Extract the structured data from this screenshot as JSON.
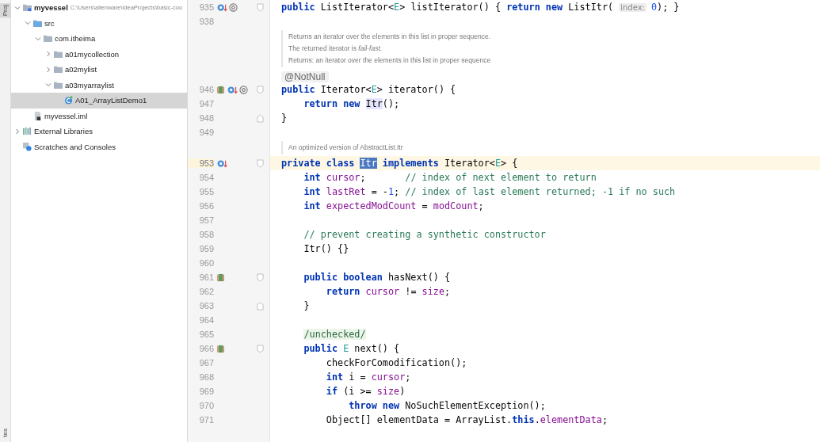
{
  "side_tabs": [
    {
      "label": "Proj"
    },
    {
      "label": "tes"
    }
  ],
  "tree": [
    {
      "label": "myvessel",
      "path": "C:\\Users\\alienware\\IdeaProjects\\basic-coo",
      "kind": "module",
      "expanded": true,
      "selected": false,
      "children": [
        {
          "label": "src",
          "kind": "source-folder",
          "expanded": true,
          "selected": false,
          "children": [
            {
              "label": "com.itheima",
              "kind": "package",
              "expanded": true,
              "selected": false,
              "children": [
                {
                  "label": "a01mycollection",
                  "kind": "package",
                  "expanded": false,
                  "selected": false
                },
                {
                  "label": "a02mylist",
                  "kind": "package",
                  "expanded": false,
                  "selected": false
                },
                {
                  "label": "a03myarraylist",
                  "kind": "package",
                  "expanded": true,
                  "selected": false,
                  "children": [
                    {
                      "label": "A01_ArrayListDemo1",
                      "kind": "class",
                      "selected": true
                    }
                  ]
                }
              ]
            }
          ]
        },
        {
          "label": "myvessel.iml",
          "kind": "iml",
          "selected": false
        }
      ]
    },
    {
      "label": "External Libraries",
      "kind": "libraries",
      "expanded": false,
      "selected": false
    },
    {
      "label": "Scratches and Consoles",
      "kind": "scratches",
      "selected": false
    }
  ],
  "editor_rows": [
    {
      "kind": "code",
      "number": "935",
      "current": false,
      "gutter": [
        {
          "kind": "overridden"
        },
        {
          "kind": "at"
        },
        {
          "kind": "fold-start"
        }
      ],
      "tokens": [
        {
          "t": "public ",
          "kind": "kw"
        },
        {
          "t": "ListIterator<",
          "kind": "plain"
        },
        {
          "t": "E",
          "kind": "tparam"
        },
        {
          "t": "> listIterator() { ",
          "kind": "plain"
        },
        {
          "t": "return new ",
          "kind": "kw"
        },
        {
          "t": "ListItr( ",
          "kind": "plain"
        },
        {
          "t": "index:",
          "kind": "hint"
        },
        {
          "t": "0",
          "kind": "num"
        },
        {
          "t": "); }",
          "kind": "plain"
        }
      ]
    },
    {
      "kind": "code",
      "number": "938",
      "current": false,
      "gutter": [],
      "tokens": []
    },
    {
      "kind": "doc",
      "lines": [
        "Returns an iterator over the elements in this list in proper sequence.",
        "The returned iterator is *fail-fast*.",
        "Returns: an iterator over the elements in this list in proper sequence"
      ]
    },
    {
      "kind": "annotation",
      "text": "@NotNull"
    },
    {
      "kind": "code",
      "number": "946",
      "current": false,
      "gutter": [
        {
          "kind": "implements"
        },
        {
          "kind": "overridden"
        },
        {
          "kind": "at"
        },
        {
          "kind": "fold-start"
        }
      ],
      "tokens": [
        {
          "t": "public ",
          "kind": "kw"
        },
        {
          "t": "Iterator<",
          "kind": "plain"
        },
        {
          "t": "E",
          "kind": "tparam"
        },
        {
          "t": "> iterator() {",
          "kind": "plain"
        }
      ]
    },
    {
      "kind": "code",
      "number": "947",
      "current": false,
      "gutter": [],
      "tokens": [
        {
          "t": "    return new ",
          "kind": "kw"
        },
        {
          "t": "Itr",
          "kind": "usage"
        },
        {
          "t": "();",
          "kind": "plain"
        }
      ]
    },
    {
      "kind": "code",
      "number": "948",
      "current": false,
      "gutter": [
        {
          "kind": "fold-end"
        }
      ],
      "tokens": [
        {
          "t": "}",
          "kind": "plain"
        }
      ]
    },
    {
      "kind": "code",
      "number": "949",
      "current": false,
      "gutter": [],
      "tokens": []
    },
    {
      "kind": "doc",
      "lines": [
        "An optimized version of AbstractList.Itr"
      ]
    },
    {
      "kind": "code",
      "number": "953",
      "current": true,
      "gutter": [
        {
          "kind": "overridden"
        },
        {
          "kind": "fold-start"
        }
      ],
      "tokens": [
        {
          "t": "private class ",
          "kind": "kw"
        },
        {
          "t": "Itr",
          "kind": "selection"
        },
        {
          "t": " implements ",
          "kind": "kw"
        },
        {
          "t": "Iterator<",
          "kind": "plain"
        },
        {
          "t": "E",
          "kind": "tparam"
        },
        {
          "t": "> {",
          "kind": "plain"
        }
      ]
    },
    {
      "kind": "code",
      "number": "954",
      "current": false,
      "gutter": [],
      "tokens": [
        {
          "t": "    int ",
          "kind": "kw"
        },
        {
          "t": "cursor",
          "kind": "field"
        },
        {
          "t": ";       ",
          "kind": "plain"
        },
        {
          "t": "// index of next element to return",
          "kind": "comment"
        }
      ]
    },
    {
      "kind": "code",
      "number": "955",
      "current": false,
      "gutter": [],
      "tokens": [
        {
          "t": "    int ",
          "kind": "kw"
        },
        {
          "t": "lastRet",
          "kind": "field"
        },
        {
          "t": " = -",
          "kind": "plain"
        },
        {
          "t": "1",
          "kind": "num"
        },
        {
          "t": "; ",
          "kind": "plain"
        },
        {
          "t": "// index of last element returned; -1 if no such",
          "kind": "comment"
        }
      ]
    },
    {
      "kind": "code",
      "number": "956",
      "current": false,
      "gutter": [],
      "tokens": [
        {
          "t": "    int ",
          "kind": "kw"
        },
        {
          "t": "expectedModCount",
          "kind": "field"
        },
        {
          "t": " = ",
          "kind": "plain"
        },
        {
          "t": "modCount",
          "kind": "field"
        },
        {
          "t": ";",
          "kind": "plain"
        }
      ]
    },
    {
      "kind": "code",
      "number": "957",
      "current": false,
      "gutter": [],
      "tokens": []
    },
    {
      "kind": "code",
      "number": "958",
      "current": false,
      "gutter": [],
      "tokens": [
        {
          "t": "    // prevent creating a synthetic constructor",
          "kind": "comment"
        }
      ]
    },
    {
      "kind": "code",
      "number": "959",
      "current": false,
      "gutter": [],
      "tokens": [
        {
          "t": "    Itr() {}",
          "kind": "plain"
        }
      ]
    },
    {
      "kind": "code",
      "number": "960",
      "current": false,
      "gutter": [],
      "tokens": []
    },
    {
      "kind": "code",
      "number": "961",
      "current": false,
      "gutter": [
        {
          "kind": "implements"
        },
        {
          "kind": "fold-start"
        }
      ],
      "tokens": [
        {
          "t": "    public boolean ",
          "kind": "kw"
        },
        {
          "t": "hasNext() {",
          "kind": "plain"
        }
      ]
    },
    {
      "kind": "code",
      "number": "962",
      "current": false,
      "gutter": [],
      "tokens": [
        {
          "t": "        return ",
          "kind": "kw"
        },
        {
          "t": "cursor",
          "kind": "field"
        },
        {
          "t": " != ",
          "kind": "plain"
        },
        {
          "t": "size",
          "kind": "field"
        },
        {
          "t": ";",
          "kind": "plain"
        }
      ]
    },
    {
      "kind": "code",
      "number": "963",
      "current": false,
      "gutter": [
        {
          "kind": "fold-end"
        }
      ],
      "tokens": [
        {
          "t": "    }",
          "kind": "plain"
        }
      ]
    },
    {
      "kind": "code",
      "number": "964",
      "current": false,
      "gutter": [],
      "tokens": []
    },
    {
      "kind": "code",
      "number": "965",
      "current": false,
      "gutter": [],
      "tokens": [
        {
          "t": "    /unchecked/",
          "kind": "inlay"
        }
      ]
    },
    {
      "kind": "code",
      "number": "966",
      "current": false,
      "gutter": [
        {
          "kind": "implements"
        },
        {
          "kind": "fold-start"
        }
      ],
      "tokens": [
        {
          "t": "    public ",
          "kind": "kw"
        },
        {
          "t": "E",
          "kind": "tparam"
        },
        {
          "t": " next() {",
          "kind": "plain"
        }
      ]
    },
    {
      "kind": "code",
      "number": "967",
      "current": false,
      "gutter": [],
      "tokens": [
        {
          "t": "        checkForComodification();",
          "kind": "plain"
        }
      ]
    },
    {
      "kind": "code",
      "number": "968",
      "current": false,
      "gutter": [],
      "tokens": [
        {
          "t": "        int ",
          "kind": "kw"
        },
        {
          "t": "i = ",
          "kind": "plain"
        },
        {
          "t": "cursor",
          "kind": "field"
        },
        {
          "t": ";",
          "kind": "plain"
        }
      ]
    },
    {
      "kind": "code",
      "number": "969",
      "current": false,
      "gutter": [],
      "tokens": [
        {
          "t": "        if ",
          "kind": "kw"
        },
        {
          "t": "(i >= ",
          "kind": "plain"
        },
        {
          "t": "size",
          "kind": "field"
        },
        {
          "t": ")",
          "kind": "plain"
        }
      ]
    },
    {
      "kind": "code",
      "number": "970",
      "current": false,
      "gutter": [],
      "tokens": [
        {
          "t": "            throw new ",
          "kind": "kw"
        },
        {
          "t": "NoSuchElementException();",
          "kind": "plain"
        }
      ]
    },
    {
      "kind": "code",
      "number": "971",
      "current": false,
      "gutter": [],
      "tokens": [
        {
          "t": "        Object[] elementData = ArrayList.",
          "kind": "plain"
        },
        {
          "t": "this",
          "kind": "kw"
        },
        {
          "t": ".",
          "kind": "plain"
        },
        {
          "t": "elementData",
          "kind": "field"
        },
        {
          "t": ";",
          "kind": "plain"
        }
      ]
    }
  ]
}
